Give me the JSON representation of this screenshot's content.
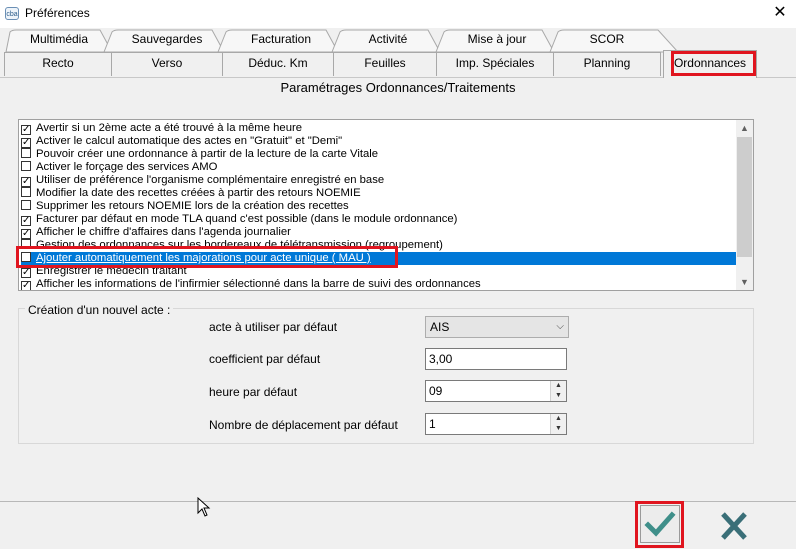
{
  "window": {
    "title": "Préférences",
    "app_icon_label": "cba"
  },
  "tabs_row1": [
    {
      "label": "Multimédia"
    },
    {
      "label": "Sauvegardes"
    },
    {
      "label": "Facturation"
    },
    {
      "label": "Activité"
    },
    {
      "label": "Mise à jour"
    },
    {
      "label": "SCOR"
    }
  ],
  "tabs_row2": [
    {
      "label": "Recto"
    },
    {
      "label": "Verso"
    },
    {
      "label": "Déduc. Km"
    },
    {
      "label": "Feuilles"
    },
    {
      "label": "Imp. Spéciales"
    },
    {
      "label": "Planning"
    },
    {
      "label": "Ordonnances",
      "active": true
    }
  ],
  "section": {
    "title": "Paramétrages Ordonnances/Traitements"
  },
  "options": [
    {
      "label": "Avertir si un 2ème acte a été trouvé à la même heure",
      "checked": true
    },
    {
      "label": "Activer le calcul automatique des actes en \"Gratuit\" et \"Demi\"",
      "checked": true
    },
    {
      "label": "Pouvoir créer une ordonnance à partir de la lecture de la carte Vitale",
      "checked": false
    },
    {
      "label": "Activer le forçage des services AMO",
      "checked": false
    },
    {
      "label": "Utiliser de préférence l'organisme complémentaire enregistré en base",
      "checked": true
    },
    {
      "label": "Modifier la date des recettes créées à partir des retours NOEMIE",
      "checked": false
    },
    {
      "label": "Supprimer les retours NOEMIE lors de la création des recettes",
      "checked": false
    },
    {
      "label": "Facturer par défaut en mode TLA quand c'est possible (dans le module ordonnance)",
      "checked": true
    },
    {
      "label": "Afficher le chiffre d'affaires dans l'agenda journalier",
      "checked": true
    },
    {
      "label": "Gestion des ordonnances sur les bordereaux de télétransmission (regroupement)",
      "checked": false
    },
    {
      "label": "Ajouter automatiquement les majorations pour acte unique ( MAU )",
      "checked": false,
      "selected": true
    },
    {
      "label": "Enregistrer le médecin traitant",
      "checked": true
    },
    {
      "label": "Afficher les informations de l'infirmier sélectionné dans la barre de suivi des ordonnances",
      "checked": true
    }
  ],
  "new_act": {
    "group_label": "Création d'un nouvel acte :",
    "act_label": "acte à utiliser par défaut",
    "act_value": "AIS",
    "coef_label": "coefficient par défaut",
    "coef_value": "3,00",
    "hour_label": "heure par défaut",
    "hour_value": "09",
    "trips_label": "Nombre de déplacement par défaut",
    "trips_value": "1"
  },
  "colors": {
    "highlight": "#e0151f",
    "selection": "#0078d7",
    "ok_check": "#3f8f8a",
    "cancel_x": "#3a6f78"
  }
}
